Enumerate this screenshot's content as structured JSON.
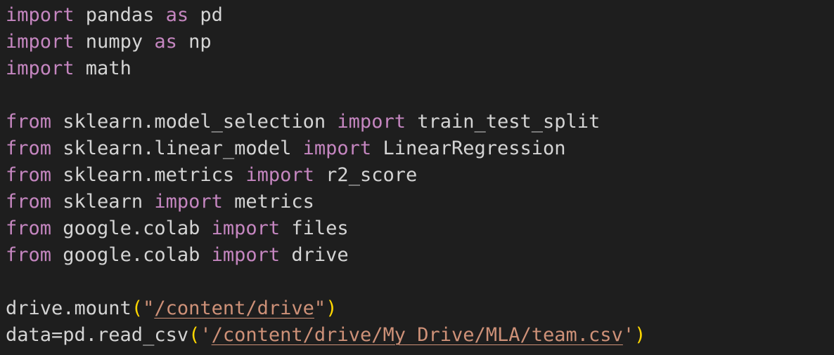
{
  "code_lines": [
    [
      {
        "text": "import",
        "type": "kw"
      },
      {
        "text": " pandas ",
        "type": "plain"
      },
      {
        "text": "as",
        "type": "kw"
      },
      {
        "text": " pd",
        "type": "plain"
      }
    ],
    [
      {
        "text": "import",
        "type": "kw"
      },
      {
        "text": " numpy ",
        "type": "plain"
      },
      {
        "text": "as",
        "type": "kw"
      },
      {
        "text": " np",
        "type": "plain"
      }
    ],
    [
      {
        "text": "import",
        "type": "kw"
      },
      {
        "text": " math",
        "type": "plain"
      }
    ],
    [],
    [
      {
        "text": "from",
        "type": "kw"
      },
      {
        "text": " sklearn.model_selection ",
        "type": "plain"
      },
      {
        "text": "import",
        "type": "kw"
      },
      {
        "text": " train_test_split",
        "type": "plain"
      }
    ],
    [
      {
        "text": "from",
        "type": "kw"
      },
      {
        "text": " sklearn.linear_model ",
        "type": "plain"
      },
      {
        "text": "import",
        "type": "kw"
      },
      {
        "text": " LinearRegression",
        "type": "plain"
      }
    ],
    [
      {
        "text": "from",
        "type": "kw"
      },
      {
        "text": " sklearn.metrics ",
        "type": "plain"
      },
      {
        "text": "import",
        "type": "kw"
      },
      {
        "text": " r2_score",
        "type": "plain"
      }
    ],
    [
      {
        "text": "from",
        "type": "kw"
      },
      {
        "text": " sklearn ",
        "type": "plain"
      },
      {
        "text": "import",
        "type": "kw"
      },
      {
        "text": " metrics",
        "type": "plain"
      }
    ],
    [
      {
        "text": "from",
        "type": "kw"
      },
      {
        "text": " google.colab ",
        "type": "plain"
      },
      {
        "text": "import",
        "type": "kw"
      },
      {
        "text": " files",
        "type": "plain"
      }
    ],
    [
      {
        "text": "from",
        "type": "kw"
      },
      {
        "text": " google.colab ",
        "type": "plain"
      },
      {
        "text": "import",
        "type": "kw"
      },
      {
        "text": " drive",
        "type": "plain"
      }
    ],
    [],
    [
      {
        "text": "drive.mount",
        "type": "plain"
      },
      {
        "text": "(",
        "type": "paren"
      },
      {
        "text": "\"",
        "type": "str"
      },
      {
        "text": "/content/drive",
        "type": "str-path"
      },
      {
        "text": "\"",
        "type": "str"
      },
      {
        "text": ")",
        "type": "paren"
      }
    ],
    [
      {
        "text": "data=pd.read_csv",
        "type": "plain"
      },
      {
        "text": "(",
        "type": "paren"
      },
      {
        "text": "'",
        "type": "str"
      },
      {
        "text": "/content/drive/My Drive/MLA/team.csv",
        "type": "str-path"
      },
      {
        "text": "'",
        "type": "str"
      },
      {
        "text": ")",
        "type": "paren"
      }
    ]
  ],
  "colors": {
    "background": "#1e1e1e",
    "keyword": "#c586c0",
    "identifier": "#d4d4d4",
    "string": "#ce9178",
    "bracket": "#ffd700"
  }
}
